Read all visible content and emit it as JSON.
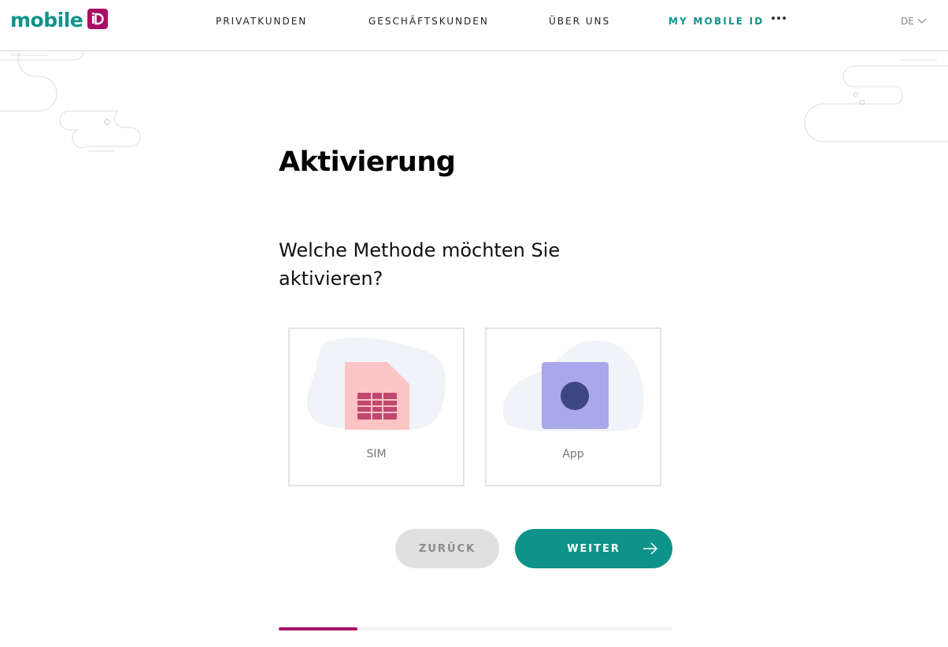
{
  "header": {
    "logo_text": "mobile",
    "logo_badge_icon": "id-badge-icon",
    "nav": [
      {
        "label": "PRIVATKUNDEN"
      },
      {
        "label": "GESCHÄFTSKUNDEN"
      },
      {
        "label": "ÜBER UNS"
      },
      {
        "label": "MY MOBILE ID",
        "active": true
      }
    ],
    "more_icon": "more-dots-icon",
    "language": "DE"
  },
  "main": {
    "title": "Aktivierung",
    "question": "Welche Methode möchten Sie aktivieren?",
    "options": [
      {
        "label": "SIM",
        "icon": "sim-card-icon"
      },
      {
        "label": "App",
        "icon": "app-icon"
      }
    ],
    "back_label": "ZURÜCK",
    "next_label": "WEITER",
    "progress_fraction": 0.2
  },
  "colors": {
    "brand_teal": "#0e938a",
    "brand_magenta": "#a80d66",
    "sim_pink": "#fcc5c5",
    "sim_chip": "#c0476e",
    "app_purple": "#a8a8eb",
    "app_dot": "#3f4582",
    "blob": "#f0f3f8"
  }
}
